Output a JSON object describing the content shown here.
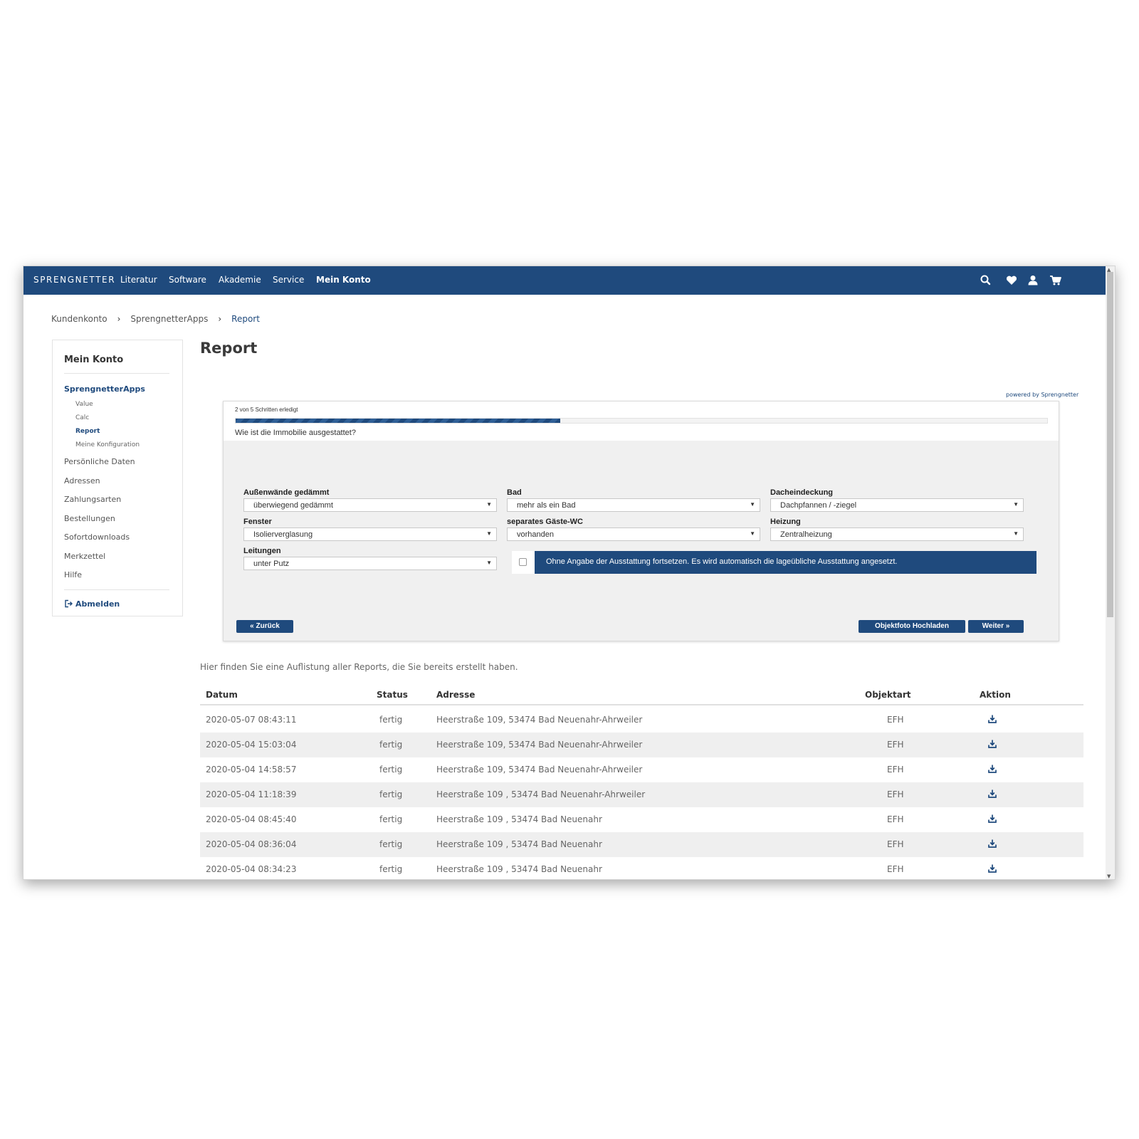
{
  "nav": {
    "logo": "SPRENGNETTER",
    "links": [
      "Literatur",
      "Software",
      "Akademie",
      "Service",
      "Mein Konto"
    ],
    "icons": [
      "search-icon",
      "heart-icon",
      "user-icon",
      "cart-icon"
    ]
  },
  "breadcrumb": [
    "Kundenkonto",
    "SprengnetterApps",
    "Report"
  ],
  "sidebar": {
    "title": "Mein Konto",
    "apps": "SprengnetterApps",
    "subitems": [
      "Value",
      "Calc",
      "Report",
      "Meine Konfiguration"
    ],
    "active_subitem": "Report",
    "items": [
      "Persönliche Daten",
      "Adressen",
      "Zahlungsarten",
      "Bestellungen",
      "Sofortdownloads",
      "Merkzettel",
      "Hilfe"
    ],
    "logout": "Abmelden"
  },
  "page_title": "Report",
  "wizard": {
    "powered_by": "powered by Sprengnetter",
    "steps_text": "2 von 5 Schritten erledigt",
    "progress": 0.4,
    "question": "Wie ist die Immobilie ausgestattet?",
    "fields": [
      {
        "label": "Außenwände gedämmt",
        "value": "überwiegend gedämmt"
      },
      {
        "label": "Bad",
        "value": "mehr als ein Bad"
      },
      {
        "label": "Dacheindeckung",
        "value": "Dachpfannen / -ziegel"
      },
      {
        "label": "Fenster",
        "value": "Isolierverglasung"
      },
      {
        "label": "separates Gäste-WC",
        "value": "vorhanden"
      },
      {
        "label": "Heizung",
        "value": "Zentralheizung"
      },
      {
        "label": "Leitungen",
        "value": "unter Putz"
      }
    ],
    "notice": "Ohne Angabe der Ausstattung fortsetzen. Es wird automatisch die lageübliche Ausstattung angesetzt.",
    "checkbox_checked": false,
    "back_label": "« Zurück",
    "upload_label": "Objektfoto Hochladen",
    "next_label": "Weiter »"
  },
  "intro_text": "Hier finden Sie eine Auflistung aller Reports, die Sie bereits erstellt haben.",
  "table": {
    "headers": [
      "Datum",
      "Status",
      "Adresse",
      "Objektart",
      "Aktion"
    ],
    "rows": [
      {
        "datum": "2020-05-07 08:43:11",
        "status": "fertig",
        "adresse": "Heerstraße 109, 53474 Bad Neuenahr-Ahrweiler",
        "objektart": "EFH"
      },
      {
        "datum": "2020-05-04 15:03:04",
        "status": "fertig",
        "adresse": "Heerstraße 109, 53474 Bad Neuenahr-Ahrweiler",
        "objektart": "EFH"
      },
      {
        "datum": "2020-05-04 14:58:57",
        "status": "fertig",
        "adresse": "Heerstraße 109, 53474 Bad Neuenahr-Ahrweiler",
        "objektart": "EFH"
      },
      {
        "datum": "2020-05-04 11:18:39",
        "status": "fertig",
        "adresse": "Heerstraße 109 , 53474 Bad Neuenahr-Ahrweiler",
        "objektart": "EFH"
      },
      {
        "datum": "2020-05-04 08:45:40",
        "status": "fertig",
        "adresse": "Heerstraße 109 , 53474 Bad Neuenahr",
        "objektart": "EFH"
      },
      {
        "datum": "2020-05-04 08:36:04",
        "status": "fertig",
        "adresse": "Heerstraße 109 , 53474 Bad Neuenahr",
        "objektart": "EFH"
      },
      {
        "datum": "2020-05-04 08:34:23",
        "status": "fertig",
        "adresse": "Heerstraße 109 , 53474 Bad Neuenahr",
        "objektart": "EFH"
      }
    ]
  },
  "colors": {
    "brand": "#1f4a7d",
    "row_alt": "#efefef"
  }
}
